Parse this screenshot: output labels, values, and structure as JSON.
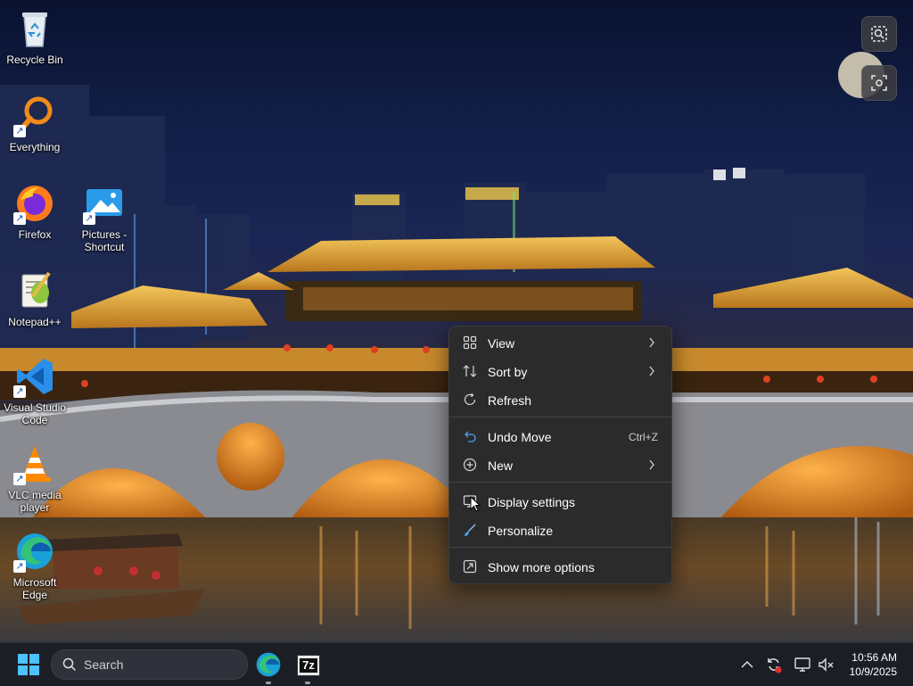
{
  "desktop": {
    "icons": [
      {
        "label": "Recycle Bin",
        "icon": "recycle-bin-icon"
      },
      {
        "label": "Everything",
        "icon": "everything-search-icon"
      },
      {
        "label": "Firefox",
        "icon": "firefox-icon"
      },
      {
        "label": "Pictures - Shortcut",
        "icon": "pictures-folder-icon"
      },
      {
        "label": "Notepad++",
        "icon": "notepad-plus-plus-icon"
      },
      {
        "label": "Visual Studio Code",
        "icon": "vscode-icon"
      },
      {
        "label": "VLC media player",
        "icon": "vlc-icon"
      },
      {
        "label": "Microsoft Edge",
        "icon": "edge-icon"
      }
    ]
  },
  "widgets": [
    {
      "icon": "image-search-icon"
    },
    {
      "icon": "screen-capture-icon"
    }
  ],
  "context_menu": {
    "items": [
      {
        "label": "View",
        "icon": "grid-view-icon",
        "submenu": true
      },
      {
        "label": "Sort by",
        "icon": "sort-icon",
        "submenu": true
      },
      {
        "label": "Refresh",
        "icon": "refresh-icon"
      },
      {
        "label": "Undo Move",
        "icon": "undo-icon",
        "shortcut": "Ctrl+Z"
      },
      {
        "label": "New",
        "icon": "new-plus-icon",
        "submenu": true
      },
      {
        "label": "Display settings",
        "icon": "display-icon"
      },
      {
        "label": "Personalize",
        "icon": "brush-icon"
      },
      {
        "label": "Show more options",
        "icon": "more-options-icon"
      }
    ]
  },
  "taskbar": {
    "search_placeholder": "Search",
    "apps": [
      {
        "name": "Microsoft Edge",
        "icon": "edge-icon"
      },
      {
        "name": "7-Zip",
        "icon": "7zip-icon",
        "label": "7z"
      }
    ],
    "tray": {
      "icons": [
        "chevron-up-icon",
        "sync-icon",
        "network-icon",
        "volume-muted-icon"
      ]
    },
    "clock": {
      "time": "10:56 AM",
      "date": "10/9/2025"
    }
  },
  "colors": {
    "menu_bg": "#2b2b2b",
    "taskbar_bg": "#1c1e26",
    "accent_blue": "#0a84ff",
    "wallpaper_gold": "#e8a23a"
  }
}
